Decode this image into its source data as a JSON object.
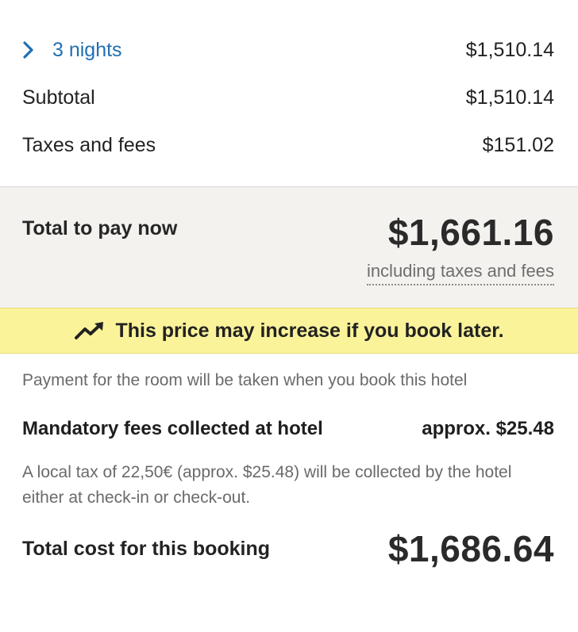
{
  "price_breakdown": {
    "nights_label": "3 nights",
    "nights_amount": "$1,510.14",
    "subtotal_label": "Subtotal",
    "subtotal_amount": "$1,510.14",
    "taxes_label": "Taxes and fees",
    "taxes_amount": "$151.02"
  },
  "pay_now": {
    "label": "Total to pay now",
    "amount": "$1,661.16",
    "sub_label": "including taxes and fees"
  },
  "price_alert": {
    "icon": "trending-up-icon",
    "text": "This price may increase if you book later."
  },
  "payment_note": "Payment for the room will be taken when you book this hotel",
  "mandatory_fees": {
    "label": "Mandatory fees collected at hotel",
    "amount": "approx. $25.48",
    "note": "A local tax of 22,50€ (approx. $25.48) will be collected by the hotel either at check-in or check-out."
  },
  "total_booking": {
    "label": "Total cost for this booking",
    "amount": "$1,686.64"
  },
  "colors": {
    "link": "#1f6fb4",
    "pay_box_bg": "#f3f2ef",
    "banner_bg": "#fbf39a",
    "muted_text": "#6a6a6a"
  }
}
